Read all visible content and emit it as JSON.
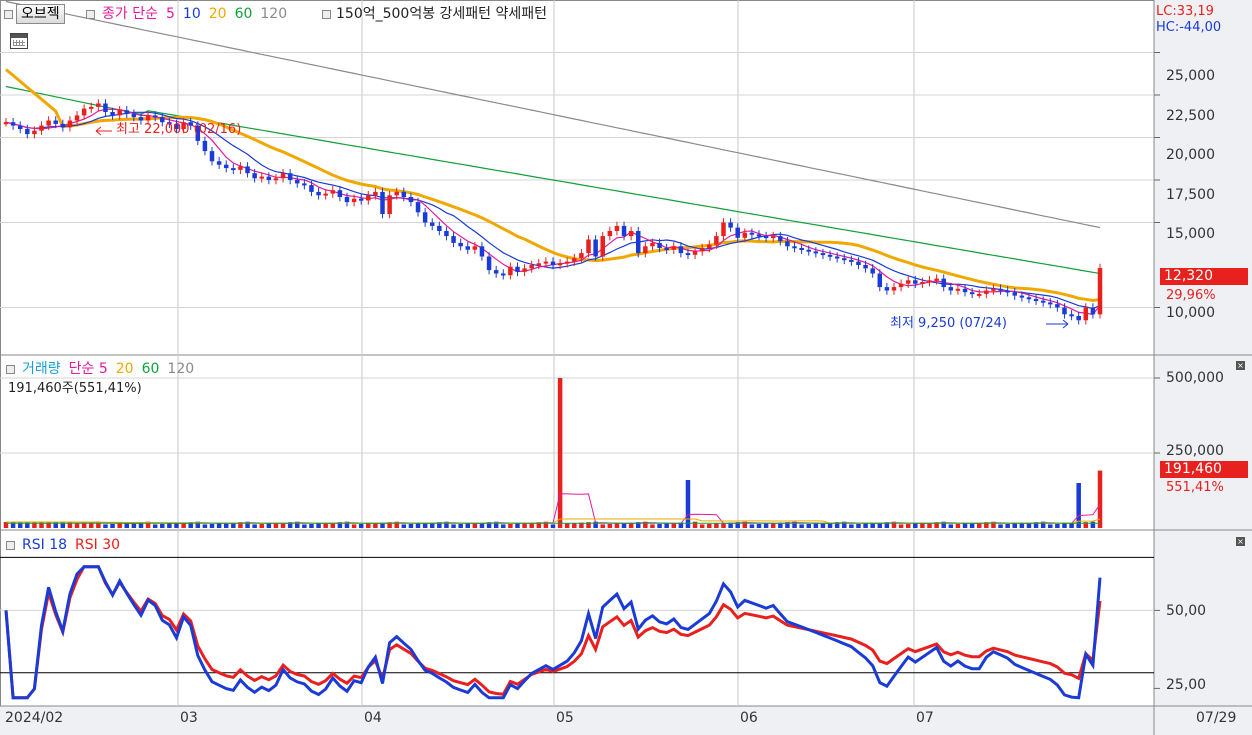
{
  "toolbar": {
    "object_button": "오브젝",
    "legend": [
      {
        "text": "종가 단순",
        "color": "#e5199b"
      },
      {
        "text": "5",
        "color": "#e5199b"
      },
      {
        "text": "10",
        "color": "#1a3bd6"
      },
      {
        "text": "20",
        "color": "#f0a800"
      },
      {
        "text": "60",
        "color": "#11a13a"
      },
      {
        "text": "120",
        "color": "#8a8a8a"
      }
    ],
    "pattern_text": "150억_500억봉 강세패턴  약세패턴"
  },
  "price_panel": {
    "lc": "LC:33,19",
    "hc": "HC:-44,00",
    "axis_ticks": [
      "25,000",
      "22,500",
      "20,000",
      "17,500",
      "15,000",
      "10,000"
    ],
    "last_price": "12,320",
    "last_change": "29,96%",
    "high_annotation": "최고 22,000 (02/16)",
    "low_annotation": "최저 9,250 (07/24)"
  },
  "volume_panel": {
    "legend": [
      {
        "text": "거래량",
        "color": "#1a9fd6"
      },
      {
        "text": "단순 5",
        "color": "#e5199b"
      },
      {
        "text": "20",
        "color": "#f0a800"
      },
      {
        "text": "60",
        "color": "#11a13a"
      },
      {
        "text": "120",
        "color": "#8a8a8a"
      }
    ],
    "info": "191,460주(551,41%)",
    "axis_ticks": [
      "500,000",
      "250,000"
    ],
    "last_volume": "191,460",
    "last_ratio": "551,41%"
  },
  "rsi_panel": {
    "legend": [
      {
        "text": "RSI 18",
        "color": "#1a3bd6"
      },
      {
        "text": "RSI 30",
        "color": "#e8201e"
      }
    ],
    "axis_ticks": [
      "50,00",
      "25,00"
    ]
  },
  "x_axis": {
    "labels": [
      "2024/02",
      "03",
      "04",
      "05",
      "06",
      "07"
    ],
    "cursor_date": "07/29"
  },
  "chart_data": [
    {
      "type": "candlestick",
      "x": [
        "2024/02",
        "03",
        "04",
        "05",
        "06",
        "07"
      ],
      "ylim": [
        7500,
        27500
      ],
      "annotations": [
        "최고 22,000 (02/16)",
        "최저 9,250 (07/24)"
      ],
      "key_points": {
        "high": 22000,
        "low": 9250,
        "last_close": 12320
      },
      "closes": [
        20900,
        20700,
        20500,
        20200,
        20400,
        20700,
        21000,
        20800,
        20600,
        21000,
        21300,
        21700,
        21800,
        22000,
        21500,
        21300,
        21600,
        21400,
        21200,
        21000,
        21300,
        21200,
        20900,
        20800,
        20500,
        20900,
        20700,
        19800,
        19200,
        18600,
        18400,
        18200,
        18100,
        18300,
        17900,
        17600,
        17700,
        17500,
        17600,
        17900,
        17500,
        17300,
        17200,
        16800,
        16600,
        16700,
        16900,
        16500,
        16200,
        16400,
        16300,
        16600,
        16800,
        15500,
        16600,
        16800,
        16500,
        16200,
        15600,
        15000,
        14800,
        14500,
        14200,
        13800,
        13600,
        13400,
        13600,
        13000,
        12200,
        12000,
        11900,
        12400,
        12100,
        12300,
        12500,
        12600,
        12700,
        12500,
        12600,
        12700,
        12900,
        13200,
        14000,
        13000,
        14200,
        14500,
        14800,
        14200,
        14500,
        13200,
        13600,
        13800,
        13500,
        13400,
        13600,
        13200,
        13100,
        13300,
        13500,
        13700,
        14200,
        15000,
        14700,
        14100,
        14400,
        14300,
        14200,
        14100,
        14200,
        13900,
        13600,
        13500,
        13400,
        13300,
        13200,
        13100,
        13000,
        12900,
        12800,
        12700,
        12500,
        12300,
        12000,
        11200,
        11000,
        11200,
        11400,
        11600,
        11400,
        11500,
        11600,
        11700,
        11200,
        11000,
        11100,
        10900,
        10800,
        10800,
        11000,
        11100,
        11000,
        10900,
        10700,
        10600,
        10500,
        10400,
        10300,
        10200,
        10000,
        9600,
        9500,
        9250,
        10000,
        9600,
        12320
      ]
    },
    {
      "type": "bar",
      "name": "거래량",
      "ylim": [
        0,
        560000
      ],
      "key_points": {
        "spike_0501": 500000,
        "spike_0524": 160000,
        "spike_0726": 150000,
        "last": 191460
      }
    },
    {
      "type": "line",
      "series": [
        {
          "name": "RSI 18"
        },
        {
          "name": "RSI 30"
        }
      ],
      "ylim": [
        20,
        70
      ],
      "guides": [
        30,
        70
      ],
      "key_points": {
        "rsi18_last": 58,
        "rsi30_last": 51
      }
    }
  ]
}
